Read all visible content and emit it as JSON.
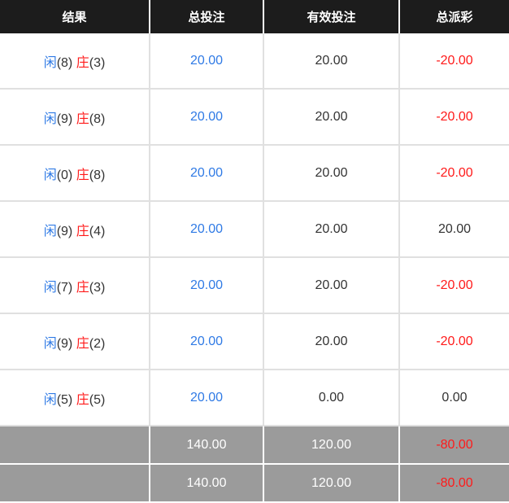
{
  "headers": [
    "结果",
    "总投注",
    "有效投注",
    "总派彩"
  ],
  "rows": [
    {
      "player_label": "闲",
      "player_score": "(8)",
      "banker_label": "庄",
      "banker_score": "(3)",
      "total_bet": "20.00",
      "valid_bet": "20.00",
      "payout": "-20.00"
    },
    {
      "player_label": "闲",
      "player_score": "(9)",
      "banker_label": "庄",
      "banker_score": "(8)",
      "total_bet": "20.00",
      "valid_bet": "20.00",
      "payout": "-20.00"
    },
    {
      "player_label": "闲",
      "player_score": "(0)",
      "banker_label": "庄",
      "banker_score": "(8)",
      "total_bet": "20.00",
      "valid_bet": "20.00",
      "payout": "-20.00"
    },
    {
      "player_label": "闲",
      "player_score": "(9)",
      "banker_label": "庄",
      "banker_score": "(4)",
      "total_bet": "20.00",
      "valid_bet": "20.00",
      "payout": "20.00"
    },
    {
      "player_label": "闲",
      "player_score": "(7)",
      "banker_label": "庄",
      "banker_score": "(3)",
      "total_bet": "20.00",
      "valid_bet": "20.00",
      "payout": "-20.00"
    },
    {
      "player_label": "闲",
      "player_score": "(9)",
      "banker_label": "庄",
      "banker_score": "(2)",
      "total_bet": "20.00",
      "valid_bet": "20.00",
      "payout": "-20.00"
    },
    {
      "player_label": "闲",
      "player_score": "(5)",
      "banker_label": "庄",
      "banker_score": "(5)",
      "total_bet": "20.00",
      "valid_bet": "0.00",
      "payout": "0.00"
    }
  ],
  "totals": [
    {
      "label": "",
      "total_bet": "140.00",
      "valid_bet": "120.00",
      "payout": "-80.00"
    },
    {
      "label": "",
      "total_bet": "140.00",
      "valid_bet": "120.00",
      "payout": "-80.00"
    }
  ],
  "colors": {
    "header_bg": "#1c1c1c",
    "player": "#2f7ae5",
    "banker": "#ff1a1a",
    "negative": "#ff1a1a",
    "neutral": "#333333",
    "total_bg": "#9b9b9b"
  }
}
